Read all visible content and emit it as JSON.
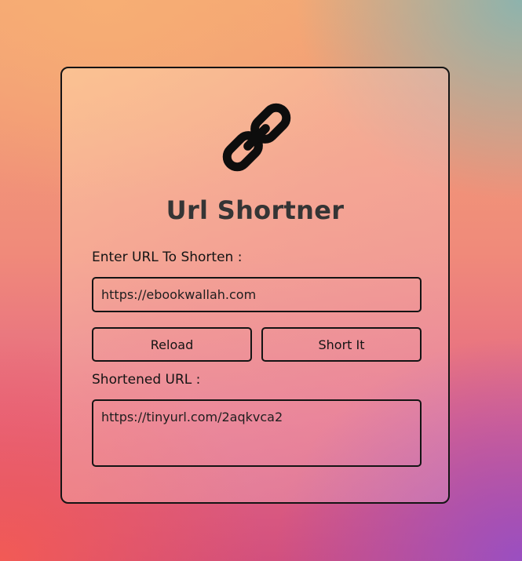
{
  "app": {
    "title": "Url Shortner",
    "logo_icon": "link-icon"
  },
  "form": {
    "url_label": "Enter URL To Shorten :",
    "url_value": "https://ebookwallah.com",
    "reload_label": "Reload",
    "short_label": "Short It",
    "result_label": "Shortened URL :",
    "result_value": "https://tinyurl.com/2aqkvca2"
  },
  "colors": {
    "text": "#141414",
    "title": "#353535",
    "border": "#141414"
  }
}
